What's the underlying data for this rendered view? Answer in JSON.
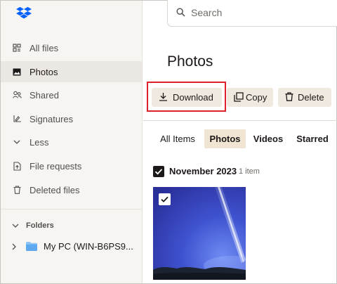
{
  "sidebar": {
    "items": [
      {
        "label": "All files",
        "icon": "all-files-icon"
      },
      {
        "label": "Photos",
        "icon": "photos-icon",
        "active": true
      },
      {
        "label": "Shared",
        "icon": "shared-icon"
      },
      {
        "label": "Signatures",
        "icon": "signature-icon"
      },
      {
        "label": "Less",
        "icon": "chevron-down-icon"
      },
      {
        "label": "File requests",
        "icon": "file-request-icon"
      },
      {
        "label": "Deleted files",
        "icon": "trash-icon"
      }
    ],
    "folders_header": "Folders",
    "folder": {
      "label": "My PC (WIN-B6PS9..."
    }
  },
  "search": {
    "placeholder": "Search"
  },
  "main": {
    "title": "Photos",
    "actions": {
      "download": "Download",
      "copy": "Copy",
      "delete": "Delete"
    },
    "tabs": [
      "All Items",
      "Photos",
      "Videos",
      "Starred"
    ],
    "active_tab": "Photos",
    "group": {
      "title": "November 2023",
      "count": "1 item"
    }
  },
  "colors": {
    "accent_highlight": "#e0202a",
    "brand": "#0061fe",
    "active_tab_bg": "#efe5d2",
    "button_bg": "#efe9df"
  }
}
